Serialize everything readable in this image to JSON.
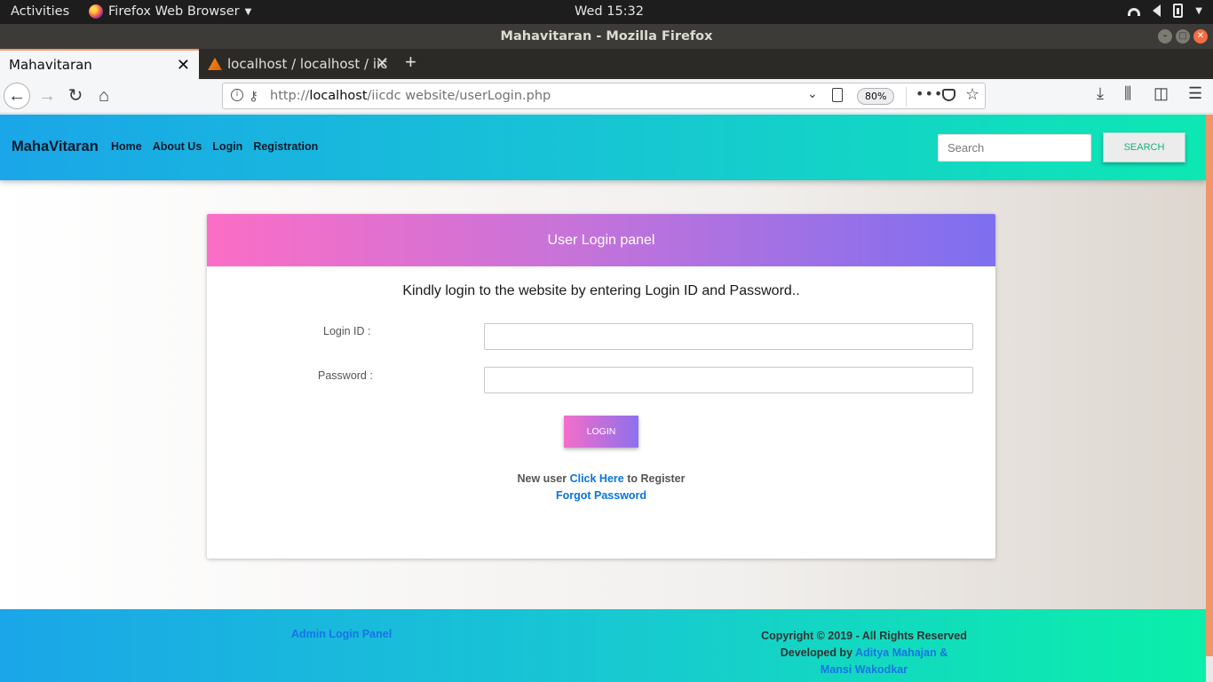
{
  "system": {
    "activities": "Activities",
    "app_menu": "Firefox Web Browser",
    "clock": "Wed 15:32"
  },
  "window": {
    "title": "Mahavitaran - Mozilla Firefox"
  },
  "tabs": [
    {
      "label": "Mahavitaran",
      "active": true
    },
    {
      "label": "localhost / localhost / iic",
      "active": false
    }
  ],
  "urlbar": {
    "protocol": "http://",
    "host": "localhost",
    "path": "/iicdc website/userLogin.php",
    "zoom": "80%"
  },
  "site": {
    "brand": "MahaVitaran",
    "nav": [
      "Home",
      "About Us",
      "Login",
      "Registration"
    ],
    "search_placeholder": "Search",
    "search_button": "SEARCH"
  },
  "login_panel": {
    "title": "User Login panel",
    "subtitle": "Kindly login to the website by entering Login ID and Password..",
    "login_id_label": "Login ID :",
    "password_label": "Password :",
    "login_button": "LOGIN",
    "new_user_prefix": "New user",
    "click_here": "Click Here",
    "register_suffix": "to Register",
    "forgot_password": "Forgot Password"
  },
  "footer": {
    "admin_link": "Admin Login Panel",
    "copyright": "Copyright © 2019 - All Rights Reserved",
    "developed_by": "Developed by",
    "developers_1": "Aditya Mahajan &",
    "developers_2": "Mansi Wakodkar"
  }
}
